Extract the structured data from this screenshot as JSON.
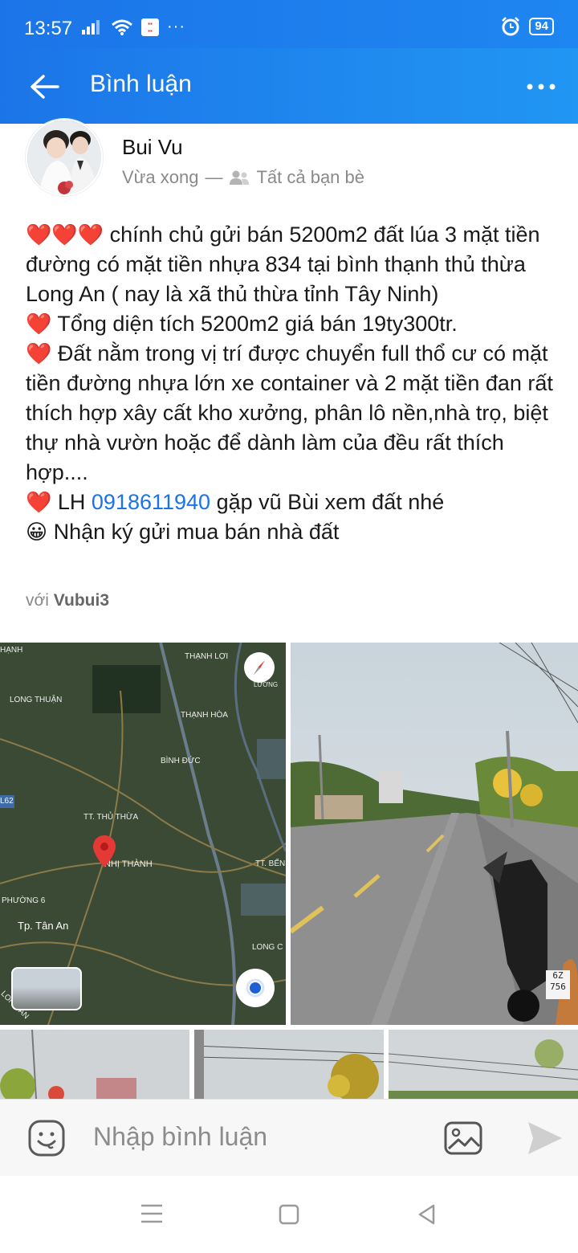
{
  "status_bar": {
    "time": "13:57",
    "battery": "94"
  },
  "app_bar": {
    "title": "Bình luận"
  },
  "post": {
    "author": "Bui Vu",
    "time": "Vừa xong",
    "separator": "—",
    "audience": "Tất cả bạn bè",
    "lines": [
      {
        "emoji": "❤️❤️❤️",
        "text": " chính chủ gửi bán 5200m2 đất lúa 3 mặt tiền đường có mặt tiền nhựa 834 tại bình thạnh thủ thừa Long An ( nay là xã thủ thừa tỉnh Tây Ninh)"
      },
      {
        "emoji": "❤️",
        "text": " Tổng diện tích 5200m2 giá bán 19ty300tr."
      },
      {
        "emoji": "❤️",
        "text": " Đất nằm trong vị trí được chuyển full thổ cư có mặt tiền đường nhựa lớn xe container và 2 mặt tiền đan rất thích hợp xây cất kho xưởng, phân lô nền,nhà trọ, biệt thự nhà vườn hoặc để dành làm của đều rất thích hợp...."
      }
    ],
    "contact": {
      "emoji": "❤️",
      "prefix": " LH ",
      "phone": "0918611940",
      "suffix": " gặp vũ Bùi xem đất nhé"
    },
    "last_line": {
      "emoji": "😀",
      "text": " Nhận ký gửi mua bán nhà đất"
    },
    "with_prefix": "với ",
    "with_name": "Vubui3"
  },
  "map_labels": {
    "thanh_loi": "THẠNH LỢI",
    "long_thuan": "LONG THUẬN",
    "thanh_hoa": "THẠNH HÒA",
    "binh_duc": "BÌNH ĐỨC",
    "tt_thu_thua": "TT. THỦ THỪA",
    "nhi_thanh": "NHỊ THÀNH",
    "tt_ben": "TT. BẾN",
    "phuong_6": "PHƯỜNG 6",
    "tan_an": "Tp. Tân An",
    "long_c": "LONG C",
    "hanh": "HẠNH",
    "luong": "LƯƠNG",
    "l62": "L62",
    "long_an": "LONG AN"
  },
  "plate": {
    "line1": "6Z",
    "line2": "756"
  },
  "composer": {
    "placeholder": "Nhập bình luận"
  }
}
